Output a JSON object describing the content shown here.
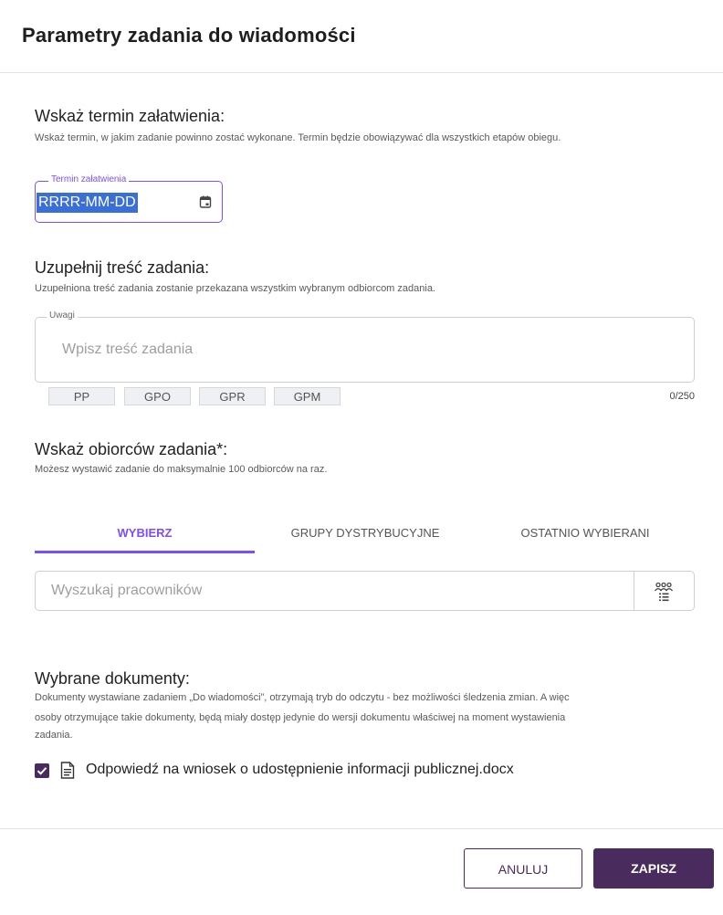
{
  "dialog": {
    "title": "Parametry zadania do wiadomości"
  },
  "deadline": {
    "heading": "Wskaż termin załatwienia:",
    "description": "Wskaż termin, w jakim zadanie powinno zostać wykonane. Termin będzie obowiązywać dla wszystkich etapów obiegu.",
    "field_label": "Termin załatwienia",
    "field_value": "RRRR-MM-DD",
    "icon": "calendar-icon"
  },
  "content": {
    "heading": "Uzupełnij treść zadania:",
    "description": "Uzupełniona treść zadania zostanie przekazana wszystkim wybranym odbiorcom zadania.",
    "notes_label": "Uwagi",
    "notes_placeholder": "Wpisz treść zadania",
    "chips": [
      "PP",
      "GPO",
      "GPR",
      "GPM"
    ],
    "char_count": "0/250"
  },
  "recipients": {
    "heading": "Wskaż obiorców zadania*:",
    "description": "Możesz wystawić zadanie do maksymalnie 100 odbiorców na raz.",
    "tabs": [
      "WYBIERZ",
      "GRUPY DYSTRYBUCYJNE",
      "OSTATNIO WYBIERANI"
    ],
    "active_tab": "WYBIERZ",
    "search_placeholder": "Wyszukaj pracowników",
    "search_icon": "group-list-icon"
  },
  "documents": {
    "heading": "Wybrane dokumenty:",
    "description_line1": "Dokumenty wystawiane zadaniem „Do wiadomości”, otrzymają tryb do odczytu - bez możliwości śledzenia zmian. A więc",
    "description_line2": "osoby otrzymujące takie dokumenty, będą miały dostęp jedynie do wersji dokumentu właściwej na moment wystawienia",
    "description_line3": "zadania.",
    "items": [
      {
        "name": "Odpowiedź na wniosek o udostępnienie informacji publicznej.docx",
        "checked": true,
        "icon": "document-icon"
      }
    ]
  },
  "footer": {
    "cancel_label": "ANULUJ",
    "save_label": "ZAPISZ"
  },
  "colors": {
    "accent": "#7c4dff",
    "primary_button": "#4a2b5e",
    "selection": "#3b6fd8"
  }
}
